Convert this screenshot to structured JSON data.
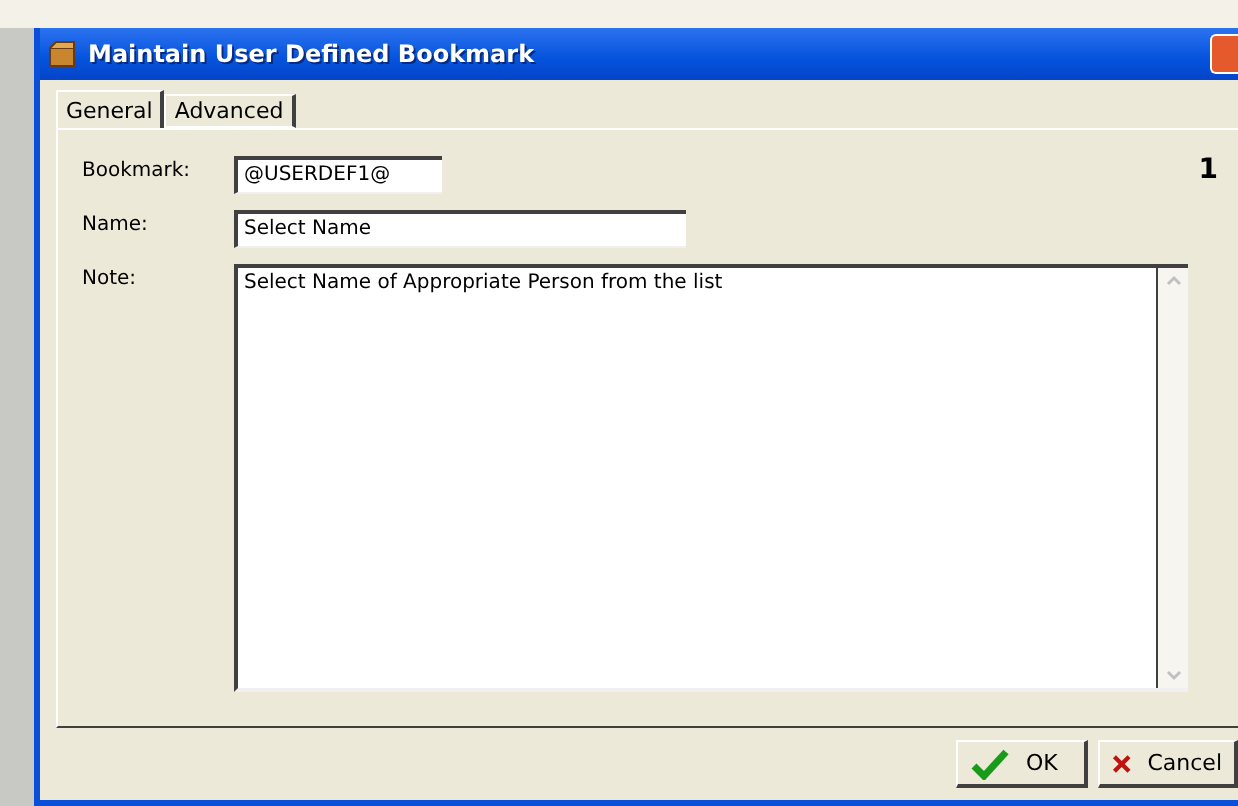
{
  "window": {
    "title": "Maintain User Defined Bookmark"
  },
  "tabs": [
    {
      "label": "General",
      "selected": true
    },
    {
      "label": "Advanced",
      "selected": false
    }
  ],
  "page_number": "1",
  "fields": [
    {
      "label": "Bookmark:",
      "value": "@USERDEF1@",
      "kind": "short"
    },
    {
      "label": "Name:",
      "value": "Select Name",
      "kind": "medium"
    },
    {
      "label": "Note:",
      "value": "Select Name of Appropriate Person from the list",
      "kind": "memo"
    }
  ],
  "buttons": [
    {
      "label": "OK",
      "kind": "ok"
    },
    {
      "label": "Cancel",
      "kind": "cancel"
    }
  ]
}
